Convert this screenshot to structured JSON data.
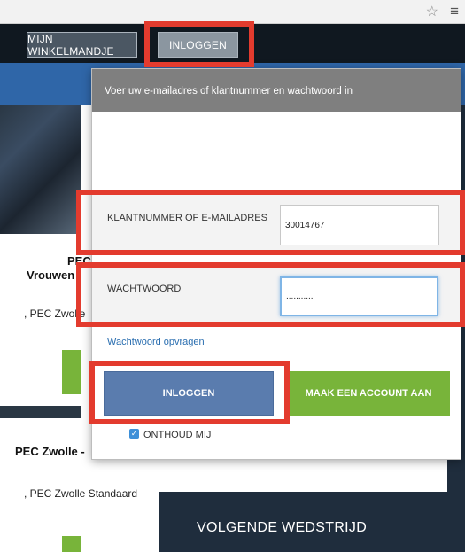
{
  "topbar": {
    "cart_label": "MIJN WINKELMANDJE",
    "login_label": "INLOGGEN"
  },
  "background": {
    "title1_line1": "PEC",
    "title1_line2": "Vrouwen",
    "subtitle1": ", PEC Zwolle",
    "title2": "PEC Zwolle -",
    "subtitle2": ", PEC Zwolle Standaard",
    "next_match": "VOLGENDE WEDSTRIJD"
  },
  "modal": {
    "header": "Voer uw e-mailadres of klantnummer en wachtwoord in",
    "customer_label": "KLANTNUMMER OF E-MAILADRES",
    "customer_value": "30014767",
    "password_label": "WACHTWOORD",
    "password_value": "...........",
    "forgot_link": "Wachtwoord opvragen",
    "login_button": "INLOGGEN",
    "create_account_button": "MAAK EEN ACCOUNT AAN",
    "remember_label": "ONTHOUD MIJ",
    "remember_checked": true
  },
  "colors": {
    "highlight": "#e33b2e",
    "login_button": "#5a7cae",
    "account_button": "#78b43a",
    "topbar": "#101820"
  }
}
